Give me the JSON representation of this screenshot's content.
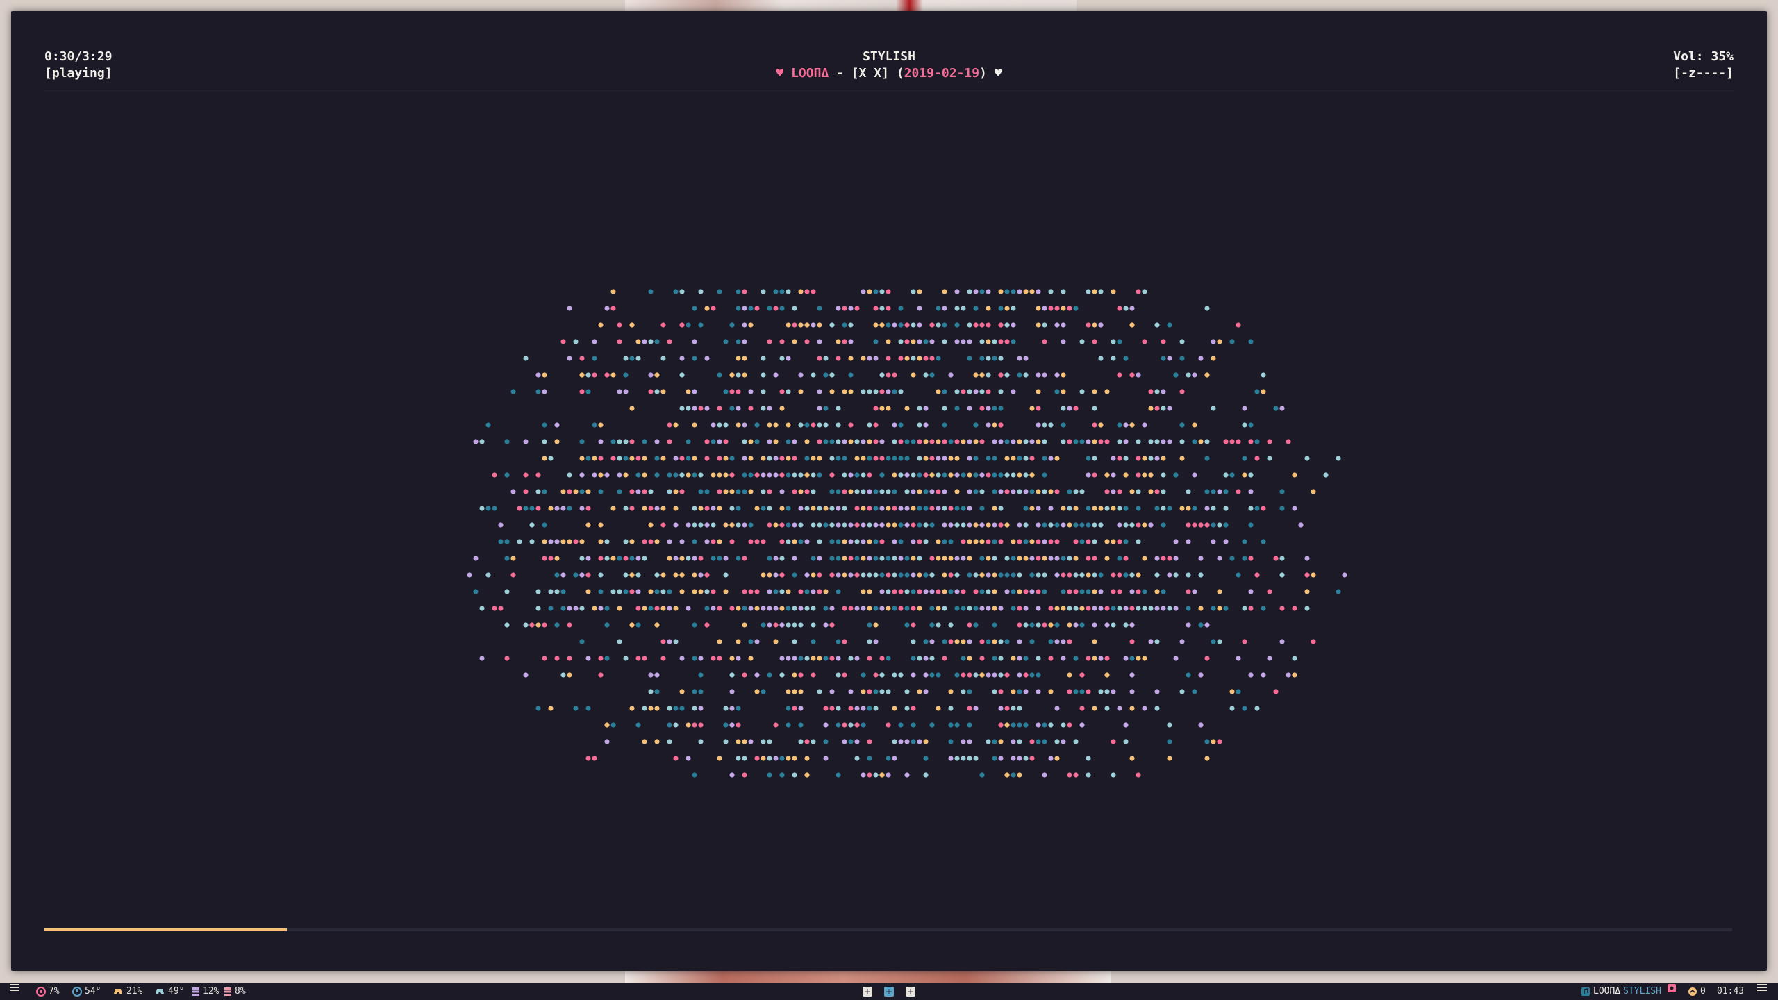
{
  "player": {
    "time": "0:30/3:29",
    "state": "[playing]",
    "volume": "Vol: 35%",
    "volume_meter": "[-z----]",
    "title": "STYLISH",
    "artist": "LOOΠΔ",
    "separator": " - ",
    "album": "[X X]",
    "release_date": "2019-02-19",
    "progress_fraction": 0.1435
  },
  "colors": {
    "background": "#1b1a26",
    "pink": "#f76d97",
    "teal": "#2a7f9b",
    "cyan": "#9ccfd8",
    "gold": "#f6c177",
    "lavender": "#c4a7e7",
    "text": "#f2eee8"
  },
  "statusbar": {
    "menu_icon": "hamburger-icon",
    "cpu": "7%",
    "cpu_temp": "54°",
    "gpu": "21%",
    "gpu_temp": "49°",
    "ram": "12%",
    "disk": "8%",
    "now_playing_artist": "LOOΠΔ",
    "now_playing_title": "STYLISH",
    "updates": "0",
    "clock": "01:43"
  }
}
